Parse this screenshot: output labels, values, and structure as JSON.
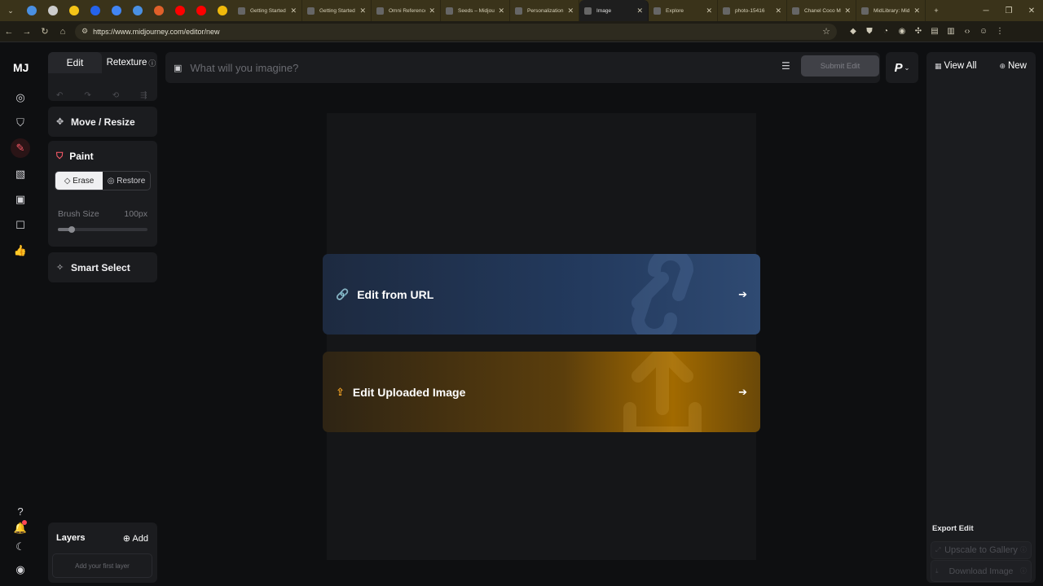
{
  "browser": {
    "pinned_tab_colors": [
      "#4a90e2",
      "#cccccc",
      "#f5c518",
      "#2563eb",
      "#4285f4",
      "#4a90e2",
      "#e0602a",
      "#ff0000",
      "#ff0000",
      "#f0b90b"
    ],
    "tabs": [
      {
        "title": "Getting Started",
        "active": false
      },
      {
        "title": "Getting Started",
        "active": false
      },
      {
        "title": "Omni Reference",
        "active": false
      },
      {
        "title": "Seeds – Midjou",
        "active": false
      },
      {
        "title": "Personalization",
        "active": false
      },
      {
        "title": "Image",
        "active": true
      },
      {
        "title": "Explore",
        "active": false
      },
      {
        "title": "photo-15416",
        "active": false
      },
      {
        "title": "Chanel Coco M",
        "active": false
      },
      {
        "title": "MidLibrary: Mid",
        "active": false
      }
    ],
    "url": "https://www.midjourney.com/editor/new"
  },
  "app": {
    "logo": "MJ",
    "tabs": {
      "edit": "Edit",
      "retexture": "Retexture"
    },
    "tools": {
      "move": "Move / Resize",
      "paint": "Paint",
      "erase": "Erase",
      "restore": "Restore",
      "brush_label": "Brush Size",
      "brush_value": "100px",
      "brush_level": 0.15,
      "smart": "Smart Select"
    },
    "prompt": {
      "placeholder": "What will you imagine?",
      "submit": "Submit Edit"
    },
    "p_menu": "P",
    "cards": {
      "url": "Edit from URL",
      "upload": "Edit Uploaded Image"
    },
    "layers": {
      "title": "Layers",
      "add": "Add",
      "empty": "Add your first layer"
    },
    "right": {
      "view_all": "View All",
      "new": "New",
      "export": "Export Edit",
      "upscale": "Upscale to Gallery",
      "download": "Download Image"
    },
    "colors": {
      "accent_red": "#ff5c6a",
      "link_blue": "#5aa2ff",
      "upload_orange": "#f0a024"
    }
  }
}
